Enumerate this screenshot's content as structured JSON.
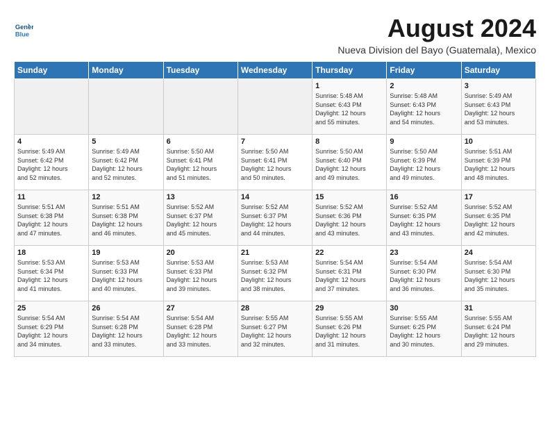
{
  "header": {
    "logo_line1": "General",
    "logo_line2": "Blue",
    "month_year": "August 2024",
    "subtitle": "Nueva Division del Bayo (Guatemala), Mexico"
  },
  "weekdays": [
    "Sunday",
    "Monday",
    "Tuesday",
    "Wednesday",
    "Thursday",
    "Friday",
    "Saturday"
  ],
  "weeks": [
    [
      {
        "day": "",
        "detail": ""
      },
      {
        "day": "",
        "detail": ""
      },
      {
        "day": "",
        "detail": ""
      },
      {
        "day": "",
        "detail": ""
      },
      {
        "day": "1",
        "detail": "Sunrise: 5:48 AM\nSunset: 6:43 PM\nDaylight: 12 hours\nand 55 minutes."
      },
      {
        "day": "2",
        "detail": "Sunrise: 5:48 AM\nSunset: 6:43 PM\nDaylight: 12 hours\nand 54 minutes."
      },
      {
        "day": "3",
        "detail": "Sunrise: 5:49 AM\nSunset: 6:43 PM\nDaylight: 12 hours\nand 53 minutes."
      }
    ],
    [
      {
        "day": "4",
        "detail": "Sunrise: 5:49 AM\nSunset: 6:42 PM\nDaylight: 12 hours\nand 52 minutes."
      },
      {
        "day": "5",
        "detail": "Sunrise: 5:49 AM\nSunset: 6:42 PM\nDaylight: 12 hours\nand 52 minutes."
      },
      {
        "day": "6",
        "detail": "Sunrise: 5:50 AM\nSunset: 6:41 PM\nDaylight: 12 hours\nand 51 minutes."
      },
      {
        "day": "7",
        "detail": "Sunrise: 5:50 AM\nSunset: 6:41 PM\nDaylight: 12 hours\nand 50 minutes."
      },
      {
        "day": "8",
        "detail": "Sunrise: 5:50 AM\nSunset: 6:40 PM\nDaylight: 12 hours\nand 49 minutes."
      },
      {
        "day": "9",
        "detail": "Sunrise: 5:50 AM\nSunset: 6:39 PM\nDaylight: 12 hours\nand 49 minutes."
      },
      {
        "day": "10",
        "detail": "Sunrise: 5:51 AM\nSunset: 6:39 PM\nDaylight: 12 hours\nand 48 minutes."
      }
    ],
    [
      {
        "day": "11",
        "detail": "Sunrise: 5:51 AM\nSunset: 6:38 PM\nDaylight: 12 hours\nand 47 minutes."
      },
      {
        "day": "12",
        "detail": "Sunrise: 5:51 AM\nSunset: 6:38 PM\nDaylight: 12 hours\nand 46 minutes."
      },
      {
        "day": "13",
        "detail": "Sunrise: 5:52 AM\nSunset: 6:37 PM\nDaylight: 12 hours\nand 45 minutes."
      },
      {
        "day": "14",
        "detail": "Sunrise: 5:52 AM\nSunset: 6:37 PM\nDaylight: 12 hours\nand 44 minutes."
      },
      {
        "day": "15",
        "detail": "Sunrise: 5:52 AM\nSunset: 6:36 PM\nDaylight: 12 hours\nand 43 minutes."
      },
      {
        "day": "16",
        "detail": "Sunrise: 5:52 AM\nSunset: 6:35 PM\nDaylight: 12 hours\nand 43 minutes."
      },
      {
        "day": "17",
        "detail": "Sunrise: 5:52 AM\nSunset: 6:35 PM\nDaylight: 12 hours\nand 42 minutes."
      }
    ],
    [
      {
        "day": "18",
        "detail": "Sunrise: 5:53 AM\nSunset: 6:34 PM\nDaylight: 12 hours\nand 41 minutes."
      },
      {
        "day": "19",
        "detail": "Sunrise: 5:53 AM\nSunset: 6:33 PM\nDaylight: 12 hours\nand 40 minutes."
      },
      {
        "day": "20",
        "detail": "Sunrise: 5:53 AM\nSunset: 6:33 PM\nDaylight: 12 hours\nand 39 minutes."
      },
      {
        "day": "21",
        "detail": "Sunrise: 5:53 AM\nSunset: 6:32 PM\nDaylight: 12 hours\nand 38 minutes."
      },
      {
        "day": "22",
        "detail": "Sunrise: 5:54 AM\nSunset: 6:31 PM\nDaylight: 12 hours\nand 37 minutes."
      },
      {
        "day": "23",
        "detail": "Sunrise: 5:54 AM\nSunset: 6:30 PM\nDaylight: 12 hours\nand 36 minutes."
      },
      {
        "day": "24",
        "detail": "Sunrise: 5:54 AM\nSunset: 6:30 PM\nDaylight: 12 hours\nand 35 minutes."
      }
    ],
    [
      {
        "day": "25",
        "detail": "Sunrise: 5:54 AM\nSunset: 6:29 PM\nDaylight: 12 hours\nand 34 minutes."
      },
      {
        "day": "26",
        "detail": "Sunrise: 5:54 AM\nSunset: 6:28 PM\nDaylight: 12 hours\nand 33 minutes."
      },
      {
        "day": "27",
        "detail": "Sunrise: 5:54 AM\nSunset: 6:28 PM\nDaylight: 12 hours\nand 33 minutes."
      },
      {
        "day": "28",
        "detail": "Sunrise: 5:55 AM\nSunset: 6:27 PM\nDaylight: 12 hours\nand 32 minutes."
      },
      {
        "day": "29",
        "detail": "Sunrise: 5:55 AM\nSunset: 6:26 PM\nDaylight: 12 hours\nand 31 minutes."
      },
      {
        "day": "30",
        "detail": "Sunrise: 5:55 AM\nSunset: 6:25 PM\nDaylight: 12 hours\nand 30 minutes."
      },
      {
        "day": "31",
        "detail": "Sunrise: 5:55 AM\nSunset: 6:24 PM\nDaylight: 12 hours\nand 29 minutes."
      }
    ]
  ]
}
